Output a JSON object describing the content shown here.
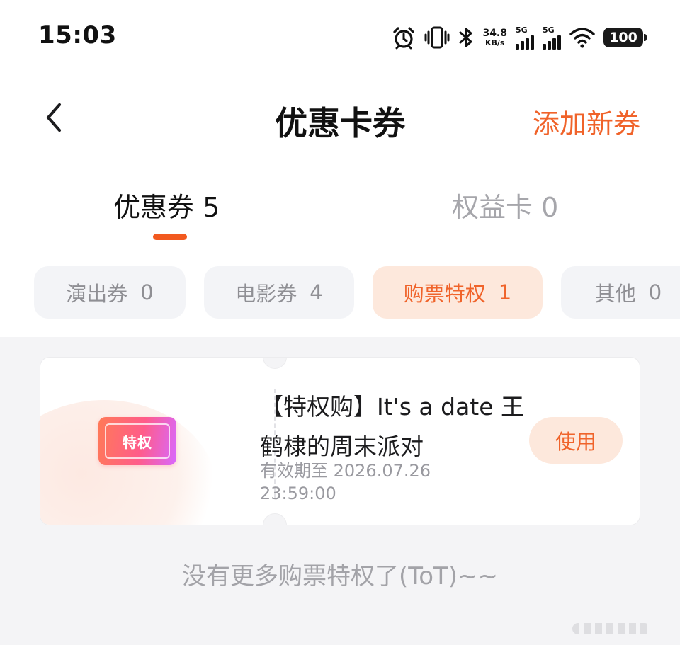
{
  "status_bar": {
    "time": "15:03",
    "net_speed_value": "34.8",
    "net_speed_unit": "KB/s",
    "sim1_tag": "5G",
    "sim2_tag": "5G",
    "battery": "100",
    "icons": [
      "alarm-icon",
      "vibrate-icon",
      "bluetooth-icon",
      "signal-icon",
      "wifi-icon",
      "battery-icon"
    ]
  },
  "header": {
    "title": "优惠卡券",
    "add_label": "添加新券",
    "accent_color": "#f0632a"
  },
  "main_tabs": [
    {
      "label": "优惠券 5",
      "active": true
    },
    {
      "label": "权益卡 0",
      "active": false
    }
  ],
  "chips": [
    {
      "label": "演出券",
      "count": "0",
      "active": false
    },
    {
      "label": "电影券",
      "count": "4",
      "active": false
    },
    {
      "label": "购票特权",
      "count": "1",
      "active": true
    },
    {
      "label": "其他",
      "count": "0",
      "active": false
    }
  ],
  "coupon": {
    "badge_text": "特权",
    "title": "【特权购】It's a date 王鹤棣的周末派对",
    "expiry": "有效期至 2026.07.26 23:59:00",
    "use_label": "使用"
  },
  "footer": {
    "no_more_text": "没有更多购票特权了(ToT)~~"
  }
}
